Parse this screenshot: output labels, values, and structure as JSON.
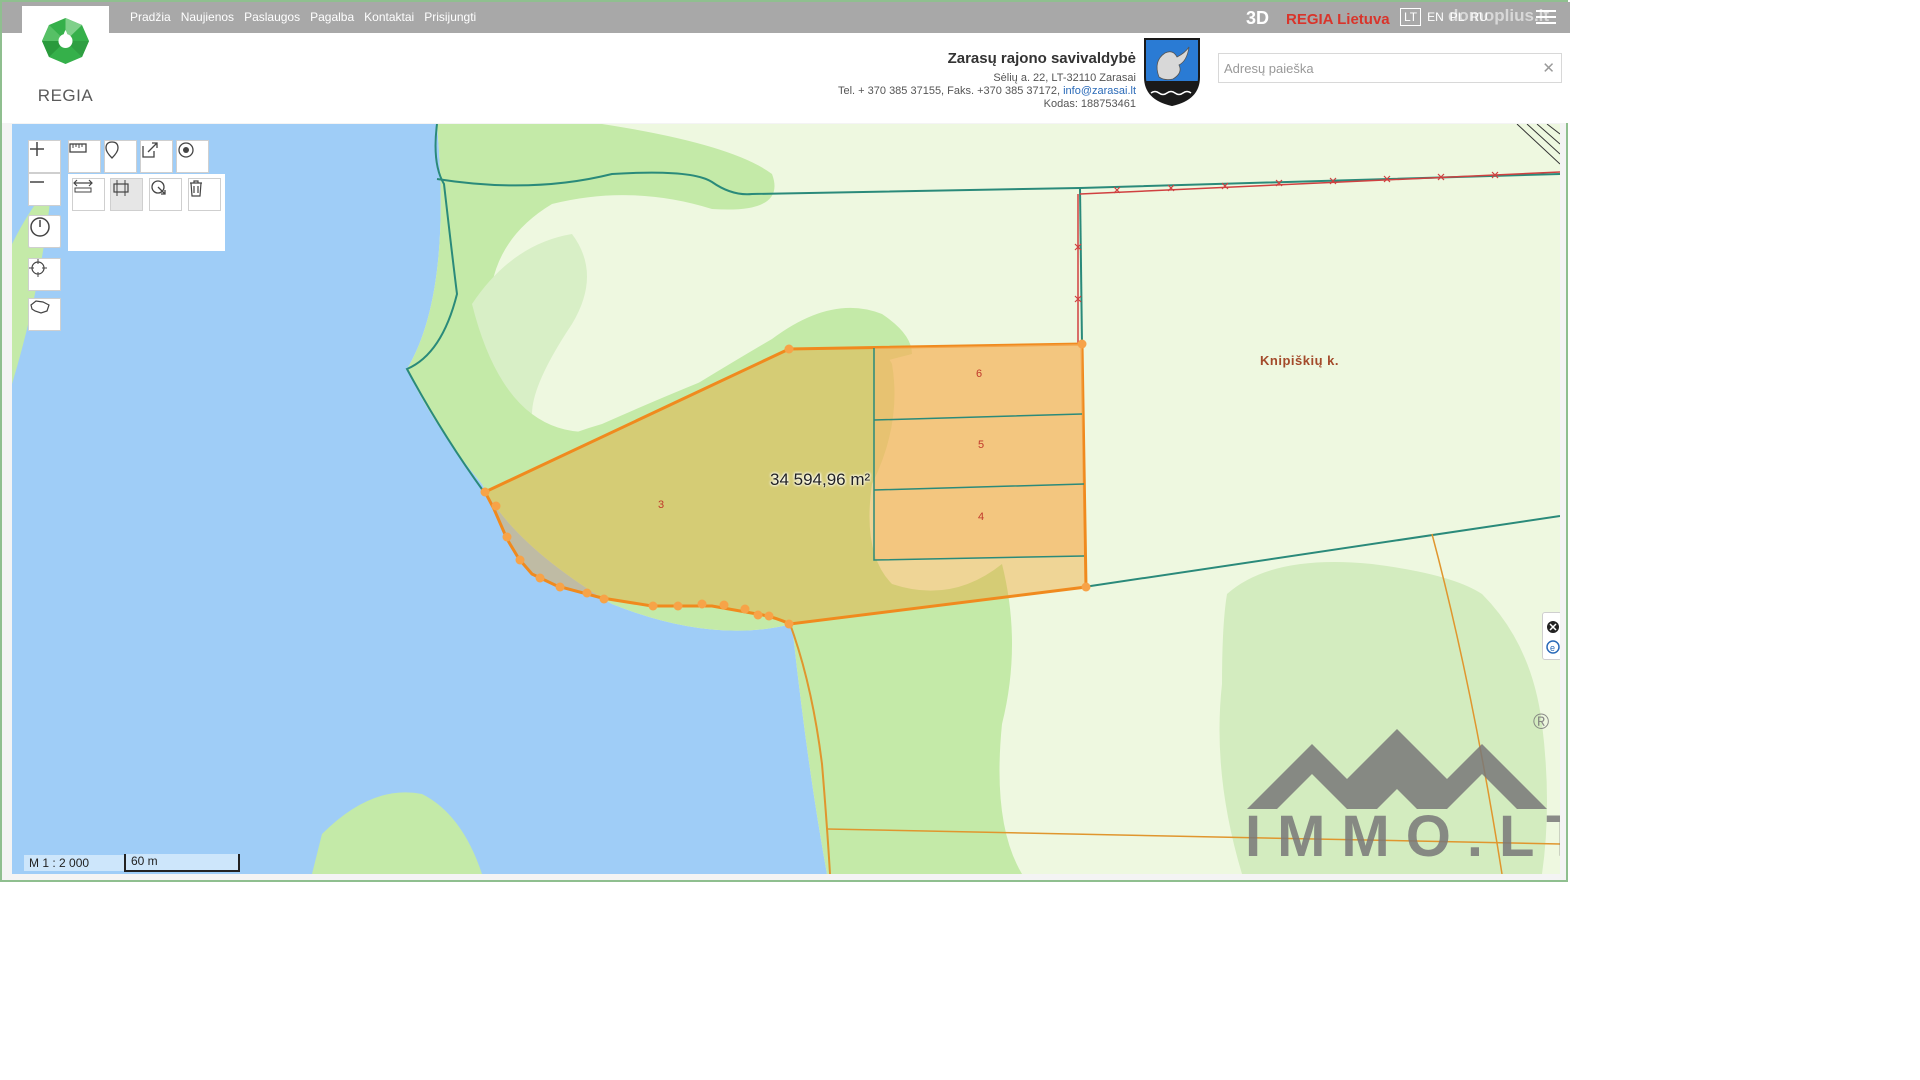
{
  "header": {
    "logo_text": "REGIA",
    "nav": [
      "Pradžia",
      "Naujienos",
      "Paslaugos",
      "Pagalba",
      "Kontaktai",
      "Prisijungti"
    ],
    "mode_3d": "3D",
    "regia_lietuva": "REGIA Lietuva",
    "languages": [
      "LT",
      "EN",
      "PL",
      "RU"
    ],
    "active_language": "LT",
    "watermark": "domoplius.lt"
  },
  "municipality": {
    "name": "Zarasų rajono savivaldybė",
    "address": "Sėlių a. 22, LT-32110 Zarasai",
    "phone_text": "Tel. + 370 385 37155, Faks. +370 385 37172,",
    "email": "info@zarasai.lt",
    "code": "Kodas: 188753461"
  },
  "search": {
    "placeholder": "Adresų paieška",
    "value": "",
    "clear_icon": "close-icon"
  },
  "map": {
    "measured_area": "34 594,96 m²",
    "village_label": "Knipiškių k.",
    "plot_numbers": [
      "6",
      "5",
      "4",
      "3"
    ],
    "scale_ratio": "M 1 : 2 000",
    "scale_distance": "60 m",
    "colors": {
      "water": "#9fcdf7",
      "forest": "#c4eaa8",
      "meadow": "#eef8e0",
      "selection": "#f08a1e",
      "parcel_line": "#2a8a7a",
      "boundary_red": "#d04040"
    }
  },
  "toolbar": {
    "tools": [
      "zoom-in",
      "zoom-out",
      "measure-ruler",
      "marker",
      "share-export",
      "target",
      "measure-distance",
      "measure-area",
      "select-area",
      "delete",
      "history",
      "locate",
      "lithuania-map"
    ]
  },
  "watermark_logo": {
    "text": "IMMO.LT",
    "registered": "®"
  }
}
